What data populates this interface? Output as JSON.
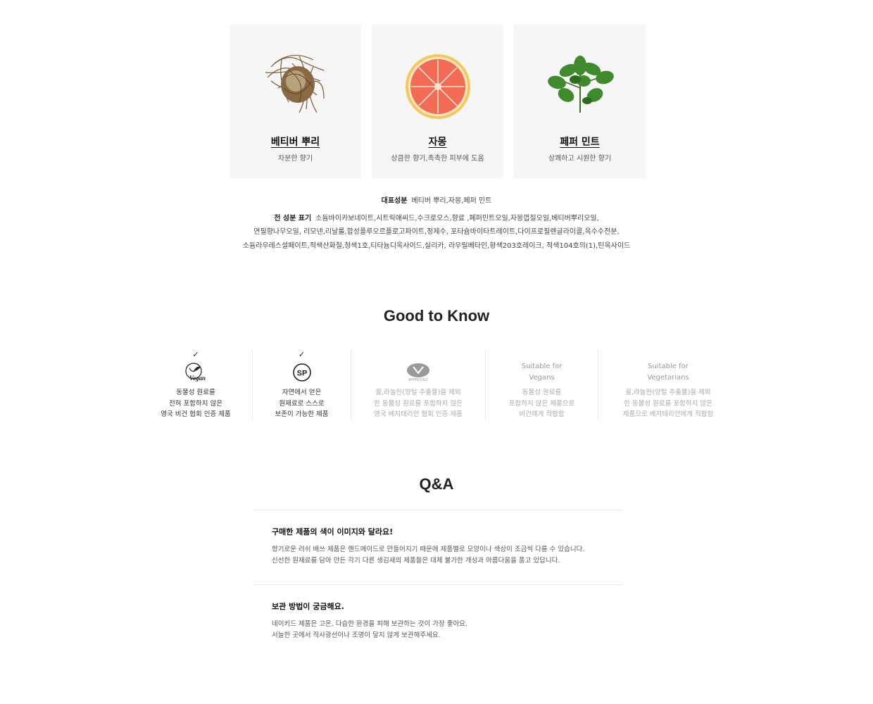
{
  "ingredients_cards": [
    {
      "name": "베티버 뿌리",
      "desc": "차분한 향기",
      "icon": "vetiver-root-image"
    },
    {
      "name": "자몽",
      "desc": "상큼한 향기,촉촉한 피부에 도움",
      "icon": "grapefruit-image"
    },
    {
      "name": "페퍼 민트",
      "desc": "상쾌하고 시원한 향기",
      "icon": "peppermint-image"
    }
  ],
  "ingredients": {
    "key_label": "대표성분",
    "key_value": "베티버 뿌리,자몽,페퍼 민트",
    "full_label": "전 성분 표기",
    "full_line1": "소듐바이카보네이트,시트릭애씨드,수크로오스,향료 ,페퍼민트오일,자몽껍질오일,베티버뿌리오일,",
    "full_line2": "연필향나무오일, 리모넨,리날룰,합성플루오르플로고파이트,정제수, 포타슘바이타트레이트,다이프로필렌글라이콜,옥수수전분,",
    "full_line3": "소듐라우레스설페이트,적색산화철,청색1호,티타늄디옥사이드,실리카, 라우릴베타인,황색203호레이크, 적색104호의(1),틴옥사이드"
  },
  "good_to_know": {
    "title": "Good to Know",
    "items": [
      {
        "check": "✓",
        "icon": "vegan-icon",
        "line1": "동물성 원료를",
        "line2": "전혀 포함하지 않은",
        "line3": "영국 비건 협회 인증 제품",
        "active": true
      },
      {
        "check": "✓",
        "icon": "sp-icon",
        "icon_text": "SP",
        "line1": "자연에서 얻은",
        "line2": "원재료로 스스로",
        "line3": "보존이 가능한 제품",
        "active": true
      },
      {
        "check": "",
        "icon": "vegetarian-approved-icon",
        "badge_text": "APPROVED",
        "line1": "꿀,라놀린(양털 추출물)을 제외",
        "line2": "한 동물성 원료를 포함하지 않은",
        "line3": "영국 베지테리언 협회 인증 제품",
        "active": false
      },
      {
        "check": "",
        "label1": "Suitable for",
        "label2": "Vegans",
        "line1": "동물성 원료를",
        "line2": "포함하지 않은 제품으로",
        "line3": "비건에게 적합함",
        "active": false
      },
      {
        "check": "",
        "label1": "Suitable for",
        "label2": "Vegetarians",
        "line1": "꿀,라놀린(양털 추출물)을 제외",
        "line2": "한 동물성 원료를 포함하지 않은",
        "line3": "제품으로 베지테리언에게 적합함",
        "active": false
      }
    ]
  },
  "qa": {
    "title": "Q&A",
    "items": [
      {
        "q": "구매한 제품의 색이 이미지와 달라요!",
        "a1": "향기로운 러쉬 배쓰 제품은 핸드메이드로 만들어지기 때문에 제품별로 모양이나 색상이 조금씩 다를 수 있습니다.",
        "a2": "신선한 원재료를 담아 만든 각기 다른 생김새의 제품들은 대체 불가한 개성과 아름다움을 품고 있답니다."
      },
      {
        "q": "보관 방법이 궁금해요.",
        "a1": "네이키드 제품은 고온, 다습한 환경을 피해 보관하는 것이 가장 좋아요.",
        "a2": "서늘한 곳에서 직사광선이나 조명이 닿지 않게 보관해주세요."
      }
    ]
  }
}
